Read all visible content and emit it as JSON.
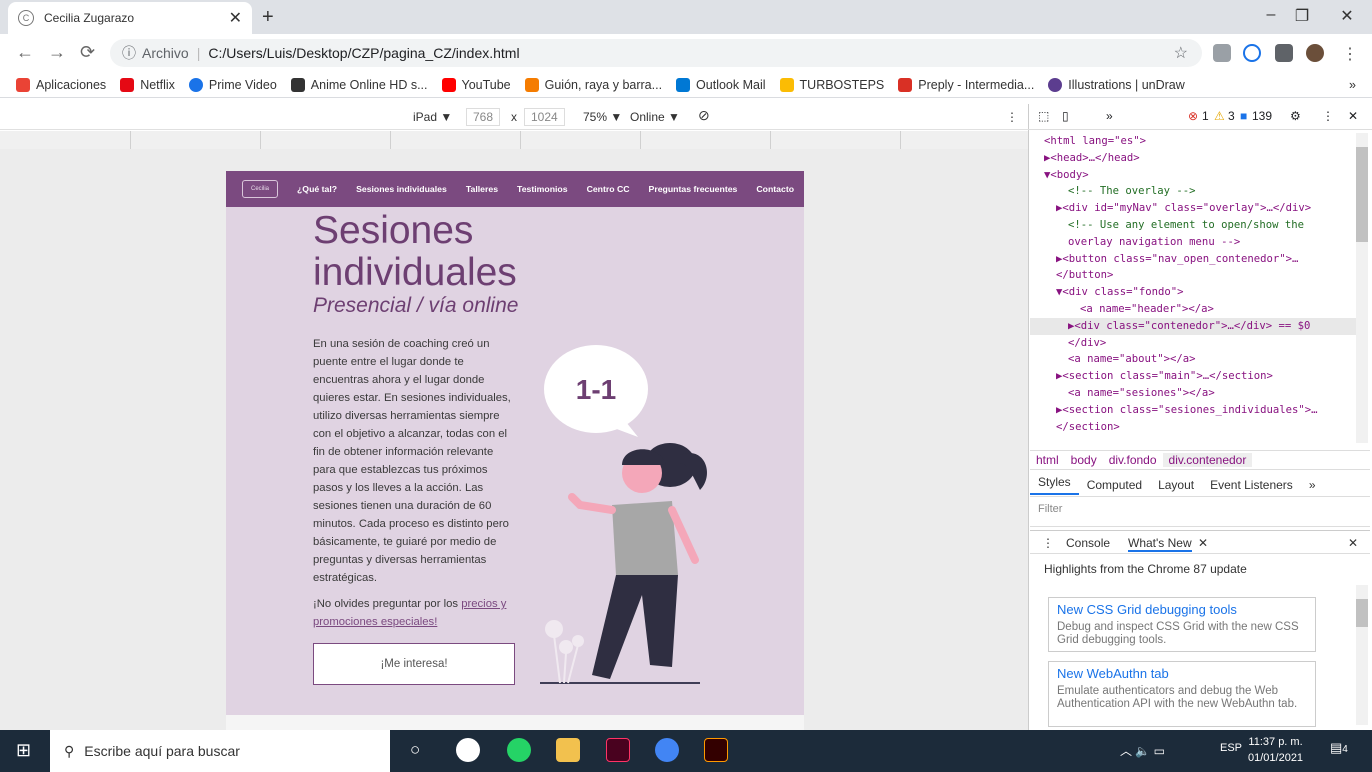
{
  "browser": {
    "tab_title": "Cecilia Zugarazo",
    "new_tab": "+",
    "window_controls": [
      "–",
      "❐",
      "✕"
    ],
    "address_prefix": "Archivo",
    "address_url": "C:/Users/Luis/Desktop/CZP/pagina_CZ/index.html",
    "bookmarks": [
      {
        "label": "Aplicaciones",
        "color": "#ea4335"
      },
      {
        "label": "Netflix",
        "color": "#e50914"
      },
      {
        "label": "Prime Video",
        "color": "#1a73e8"
      },
      {
        "label": "Anime Online HD s...",
        "color": "#333333"
      },
      {
        "label": "YouTube",
        "color": "#ff0000"
      },
      {
        "label": "Guión, raya y barra...",
        "color": "#f57c00"
      },
      {
        "label": "Outlook Mail",
        "color": "#0078d4"
      },
      {
        "label": "TURBOSTEPS",
        "color": "#fbbc04"
      },
      {
        "label": "Preply - Intermedia...",
        "color": "#d93025"
      },
      {
        "label": "Illustrations | unDraw",
        "color": "#5c3d8f"
      }
    ],
    "more_bookmarks": "»"
  },
  "device_toolbar": {
    "device": "iPad ▼",
    "width": "768",
    "times": "x",
    "height": "1024",
    "zoom": "75% ▼",
    "network": "Online ▼",
    "more": "⋮"
  },
  "site": {
    "logo_text": "Cecilia",
    "nav": [
      "¿Qué tal?",
      "Sesiones individuales",
      "Talleres",
      "Testimonios",
      "Centro CC",
      "Preguntas frecuentes",
      "Contacto"
    ],
    "title": "Sesiones individuales",
    "subtitle": "Presencial / vía online",
    "paragraph": "En una sesión de coaching creó un puente entre el lugar donde te encuentras ahora y el lugar donde quieres estar. En sesiones individuales, utilizo diversas herramientas siempre con el objetivo a alcanzar, todas con el fin de obtener información relevante para que establezcas tus próximos pasos y los lleves a la acción. Las sesiones tienen una duración de 60 minutos. Cada proceso es distinto pero básicamente, te guiaré por medio de preguntas y diversas herramientas estratégicas.",
    "reminder_prefix": "¡No olvides preguntar por los ",
    "reminder_link": "precios y promociones especiales!",
    "cta": "¡Me interesa!",
    "bubble": "1-1"
  },
  "devtools": {
    "toolbar_more": "»",
    "errors": "1",
    "warnings": "3",
    "messages": "139",
    "dom_lines": [
      {
        "indent": 0,
        "html": "<html lang=\"es\">"
      },
      {
        "indent": 0,
        "html": "▶<head>…</head>"
      },
      {
        "indent": 0,
        "html": "▼<body>"
      },
      {
        "indent": 2,
        "html": "<!-- The overlay -->"
      },
      {
        "indent": 1,
        "html": "▶<div id=\"myNav\" class=\"overlay\">…</div>"
      },
      {
        "indent": 2,
        "html": "<!-- Use any element to open/show the"
      },
      {
        "indent": 2,
        "html": "overlay navigation menu -->"
      },
      {
        "indent": 1,
        "html": "▶<button class=\"nav_open_contenedor\">…"
      },
      {
        "indent": 1,
        "html": "</button>"
      },
      {
        "indent": 1,
        "html": "▼<div class=\"fondo\">"
      },
      {
        "indent": 3,
        "html": "<a name=\"header\"></a>"
      },
      {
        "indent": 2,
        "html": "▶<div class=\"contenedor\">…</div> == $0"
      },
      {
        "indent": 2,
        "html": "</div>"
      },
      {
        "indent": 2,
        "html": "<a name=\"about\"></a>"
      },
      {
        "indent": 1,
        "html": "▶<section class=\"main\">…</section>"
      },
      {
        "indent": 2,
        "html": "<a name=\"sesiones\"></a>"
      },
      {
        "indent": 1,
        "html": "▶<section class=\"sesiones_individuales\">…"
      },
      {
        "indent": 1,
        "html": "</section>"
      }
    ],
    "breadcrumbs": [
      "html",
      "body",
      "div.fondo",
      "div.contenedor"
    ],
    "style_tabs": [
      "Styles",
      "Computed",
      "Layout",
      "Event Listeners",
      "»"
    ],
    "filter_placeholder": "Filter",
    "drawer_tabs": [
      "Console",
      "What's New"
    ],
    "highlights": "Highlights from the Chrome 87 update",
    "news": [
      {
        "title": "New CSS Grid debugging tools",
        "desc": "Debug and inspect CSS Grid with the new CSS Grid debugging tools."
      },
      {
        "title": "New WebAuthn tab",
        "desc": "Emulate authenticators and debug the Web Authentication API with the new WebAuthn tab."
      }
    ]
  },
  "taskbar": {
    "search_placeholder": "Escribe aquí para buscar",
    "language": "ESP",
    "time": "11:37 p. m.",
    "date": "01/01/2021",
    "notifications": "4"
  }
}
